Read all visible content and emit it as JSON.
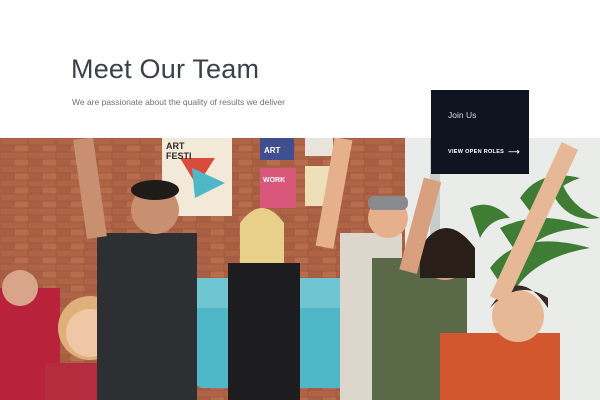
{
  "section": {
    "title": "Meet Our Team",
    "subtitle": "We are passionate about the quality of results we deliver"
  },
  "join_card": {
    "title": "Join Us",
    "link_label": "VIEW OPEN ROLES",
    "link_icon": "arrow-right-icon"
  },
  "photo": {
    "poster_text_1": "ART",
    "poster_text_2": "FESTI",
    "poster_text_3": "ART",
    "poster_text_4": "WORK"
  },
  "colors": {
    "title": "#3a3f4a",
    "card_bg": "#0f1420",
    "brick": "#a2583f",
    "sofa": "#4fb7c7"
  }
}
